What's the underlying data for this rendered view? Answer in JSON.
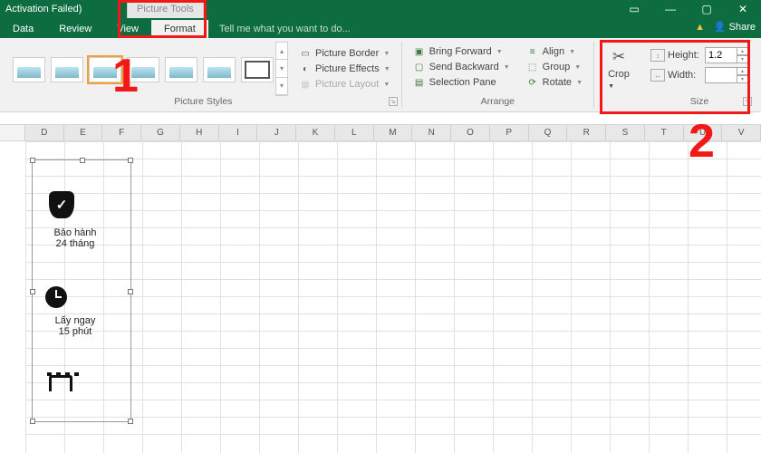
{
  "title": {
    "activation": "Activation Failed)",
    "context_tab": "Picture Tools"
  },
  "tabs": {
    "data": "Data",
    "review": "Review",
    "view": "View",
    "format": "Format",
    "hint": "Tell me what you want to do...",
    "share": "Share"
  },
  "ribbon": {
    "styles_label": "Picture Styles",
    "border": "Picture Border",
    "effects": "Picture Effects",
    "layout": "Picture Layout",
    "arrange_label": "Arrange",
    "forward": "Bring Forward",
    "backward": "Send Backward",
    "selpane": "Selection Pane",
    "align": "Align",
    "group": "Group",
    "rotate": "Rotate",
    "crop": "Crop",
    "size_label": "Size",
    "height_lbl": "Height:",
    "width_lbl": "Width:",
    "height_val": "1.2",
    "width_val": ""
  },
  "columns": [
    "D",
    "E",
    "F",
    "G",
    "H",
    "I",
    "J",
    "K",
    "L",
    "M",
    "N",
    "O",
    "P",
    "Q",
    "R",
    "S",
    "T",
    "U",
    "V"
  ],
  "content": {
    "warranty_l1": "Bảo hành",
    "warranty_l2": "24 tháng",
    "pickup_l1": "Lấy ngay",
    "pickup_l2": "15 phút"
  },
  "annot": {
    "one": "1",
    "two": "2"
  }
}
